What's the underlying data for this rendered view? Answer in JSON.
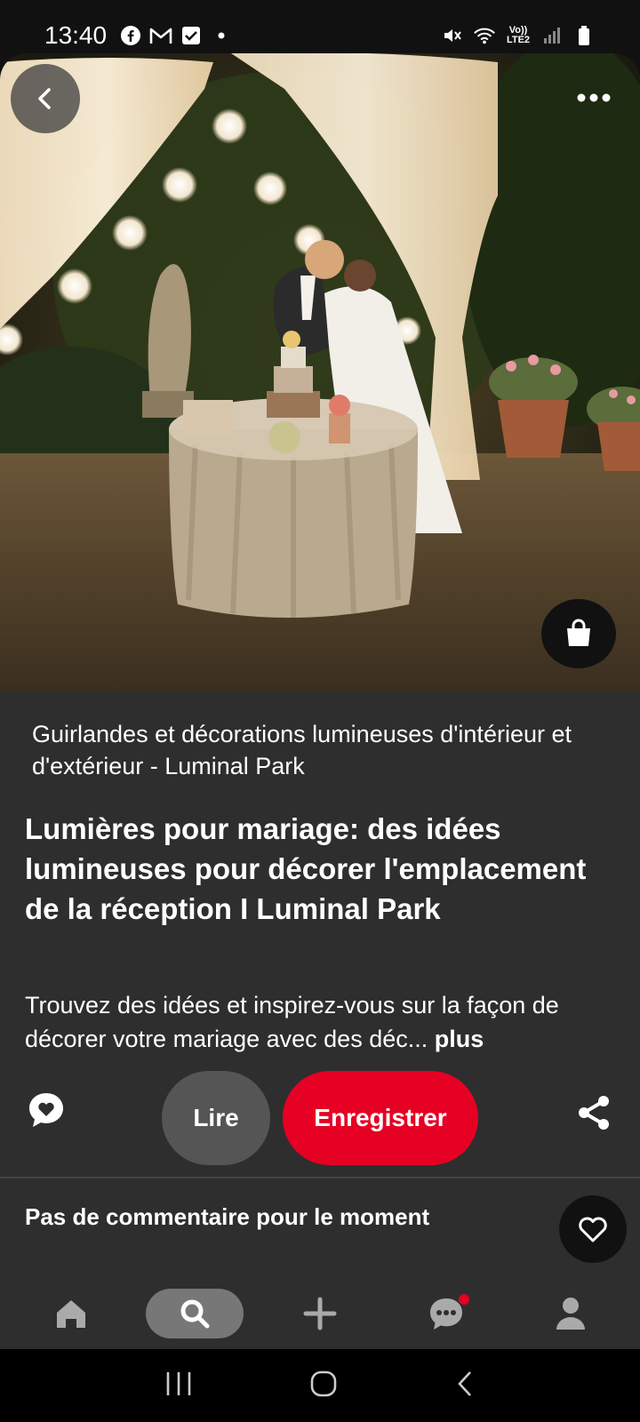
{
  "status_bar": {
    "time": "13:40",
    "left_icons": [
      "facebook-icon",
      "gmail-icon",
      "checkbox-icon",
      "dot-icon"
    ],
    "right_icons": [
      "mute-icon",
      "wifi-icon",
      "volte-icon",
      "signal-icon",
      "battery-icon"
    ],
    "volte_label": "Vo)) LTE2"
  },
  "hero": {
    "image_description_icon": "wedding-photo",
    "back_icon": "back-icon",
    "more_icon": "more-icon",
    "shop_icon": "shopping-bag-icon"
  },
  "pin": {
    "source": "Guirlandes et décorations lumineuses d'intérieur et d'extérieur - Luminal Park",
    "title": "Lumières pour mariage: des idées lumineuses pour décorer l'emplacement de la réception I Luminal Park",
    "description": "Trouvez des idées et inspirez-vous sur la façon de décorer votre mariage avec des déc...",
    "more_label": "plus"
  },
  "actions": {
    "read_label": "Lire",
    "save_label": "Enregistrer",
    "comment_icon": "comment-heart-icon",
    "share_icon": "share-icon"
  },
  "comments": {
    "empty_label": "Pas de commentaire pour le moment",
    "heart_icon": "heart-icon"
  },
  "bottom_nav": {
    "items": [
      "home-icon",
      "search-icon",
      "plus-icon",
      "messages-icon",
      "profile-icon"
    ]
  },
  "system_nav": {
    "items": [
      "recents-icon",
      "home-circle-icon",
      "back-chevron-icon"
    ]
  },
  "colors": {
    "accent": "#e60023",
    "panel": "#2e2e2e",
    "background": "#111111"
  }
}
